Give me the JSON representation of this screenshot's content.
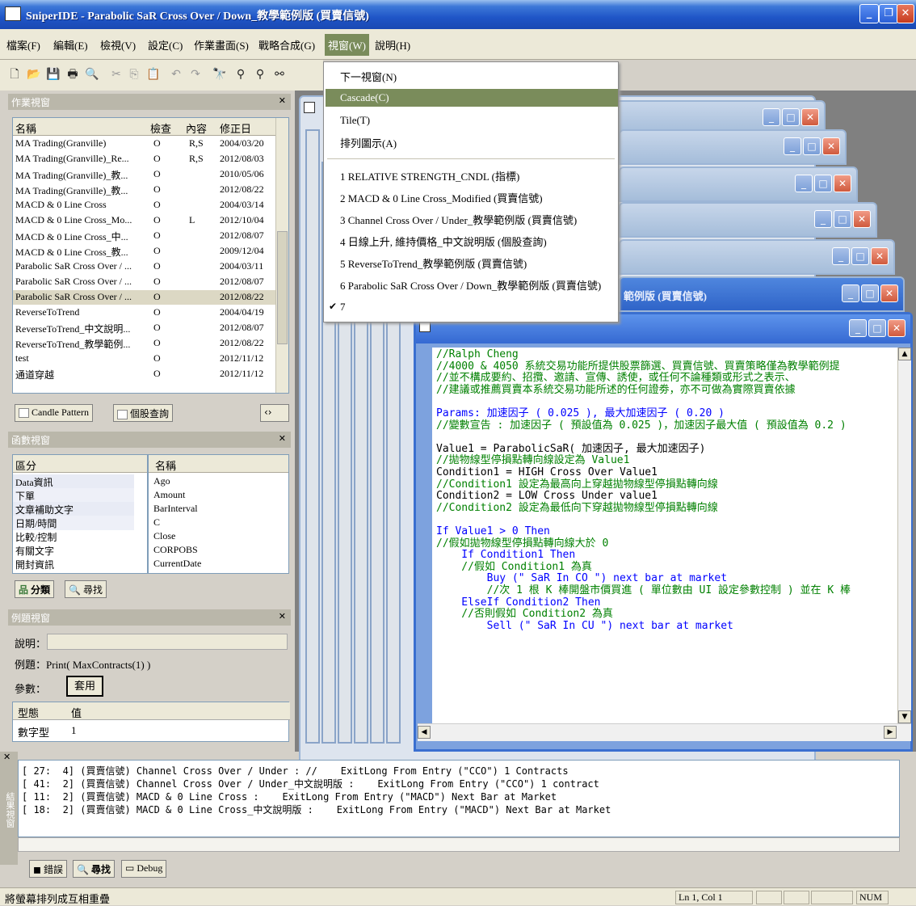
{
  "title": "SniperIDE - Parabolic SaR Cross Over / Down_教學範例版 (買賣信號)",
  "menu": [
    "檔案(F)",
    "編輯(E)",
    "檢視(V)",
    "設定(C)",
    "作業畫面(S)",
    "戰略合成(G)",
    "視窗(W)",
    "說明(H)"
  ],
  "window_menu": {
    "next": "下一視窗(N)",
    "cascade": "Cascade(C)",
    "tile": "Tile(T)",
    "arrange": "排列圖示(A)",
    "windows": [
      "1 RELATIVE STRENGTH_CNDL (指標)",
      "2 MACD & 0 Line Cross_Modified (買賣信號)",
      "3 Channel Cross Over / Under_教學範例版 (買賣信號)",
      "4 日線上升, 維持價格_中文說明版 (個股查詢)",
      "5 ReverseToTrend_教學範例版 (買賣信號)",
      "6 Parabolic SaR Cross Over / Down_教學範例版 (買賣信號)",
      "7"
    ]
  },
  "work_panel": {
    "title": "作業視窗",
    "headers": [
      "名稱",
      "檢查",
      "內容",
      "修正日"
    ],
    "rows": [
      [
        "MA Trading(Granville)",
        "O",
        "R,S",
        "2004/03/20"
      ],
      [
        "MA Trading(Granville)_Re...",
        "O",
        "R,S",
        "2012/08/03"
      ],
      [
        "MA Trading(Granville)_教...",
        "O",
        "",
        "2010/05/06"
      ],
      [
        "MA Trading(Granville)_教...",
        "O",
        "",
        "2012/08/22"
      ],
      [
        "MACD & 0 Line Cross",
        "O",
        "",
        "2004/03/14"
      ],
      [
        "MACD & 0 Line Cross_Mo...",
        "O",
        "L",
        "2012/10/04"
      ],
      [
        "MACD & 0 Line Cross_中...",
        "O",
        "",
        "2012/08/07"
      ],
      [
        "MACD & 0 Line Cross_教...",
        "O",
        "",
        "2009/12/04"
      ],
      [
        "Parabolic SaR Cross Over / ...",
        "O",
        "",
        "2004/03/11"
      ],
      [
        "Parabolic SaR Cross Over / ...",
        "O",
        "",
        "2012/08/07"
      ],
      [
        "Parabolic SaR Cross Over / ...",
        "O",
        "",
        "2012/08/22"
      ],
      [
        "ReverseToTrend",
        "O",
        "",
        "2004/04/19"
      ],
      [
        "ReverseToTrend_中文說明...",
        "O",
        "",
        "2012/08/07"
      ],
      [
        "ReverseToTrend_教學範例...",
        "O",
        "",
        "2012/08/22"
      ],
      [
        "test",
        "O",
        "",
        "2012/11/12"
      ],
      [
        "通道穿越",
        "O",
        "",
        "2012/11/12"
      ]
    ],
    "tabs": [
      "Candle Pattern",
      "個股查詢"
    ]
  },
  "func_panel": {
    "title": "函數視窗",
    "col1": "區分",
    "col2": "名稱",
    "categories": [
      "Data資訊",
      "下單",
      "文章補助文字",
      "日期/時間",
      "比較/控制",
      "有關文字",
      "開封資訊"
    ],
    "names": [
      "Ago",
      "Amount",
      "BarInterval",
      "C",
      "Close",
      "CORPOBS",
      "CurrentDate"
    ],
    "tabs": [
      "分類",
      "尋找"
    ]
  },
  "example_panel": {
    "title": "例題視窗",
    "desc_label": "說明：",
    "example_label": "例題：",
    "example_value": "Print( MaxContracts(1) )",
    "param_label": "參數：",
    "apply_button": "套用",
    "type_header": "型態",
    "value_header": "值",
    "type_row": "數字型",
    "value_row": "1"
  },
  "mdi_tail": "範例版 (買賣信號)",
  "code": [
    {
      "t": "//Ralph Cheng",
      "c": "green"
    },
    {
      "t": "//4000 & 4050 系統交易功能所提供股票篩選、買賣信號、買賣策略僅為教學範例提",
      "c": "green"
    },
    {
      "t": "//並不構成要約、招攬、邀請、宣傳、誘使，或任何不論種類或形式之表示、",
      "c": "green"
    },
    {
      "t": "//建議或推薦買賣本系統交易功能所述的任何證劵，亦不可做為實際買賣依據",
      "c": "green"
    },
    {
      "t": "",
      "c": "blk"
    },
    {
      "t": "Params: 加速因子 ( 0.025 ), 最大加速因子 ( 0.20 )",
      "c": "blue"
    },
    {
      "t": "//變數宣告 : 加速因子 ( 預設值為 0.025 )，加速因子最大值 ( 預設值為 0.2 )",
      "c": "green"
    },
    {
      "t": "",
      "c": "blk"
    },
    {
      "t": "Value1 = ParabolicSaR( 加速因子, 最大加速因子)",
      "c": "blk"
    },
    {
      "t": "//拋物線型停損點轉向線設定為 Value1",
      "c": "green"
    },
    {
      "t": "Condition1 = HIGH Cross Over Value1",
      "c": "blk"
    },
    {
      "t": "//Condition1 設定為最高向上穿越拋物線型停損點轉向線",
      "c": "green"
    },
    {
      "t": "Condition2 = LOW Cross Under value1",
      "c": "blk"
    },
    {
      "t": "//Condition2 設定為最低向下穿越拋物線型停損點轉向線",
      "c": "green"
    },
    {
      "t": "",
      "c": "blk"
    },
    {
      "t": "If Value1 > 0 Then",
      "c": "blue"
    },
    {
      "t": "//假如拋物線型停損點轉向線大於 0",
      "c": "green"
    },
    {
      "t": "    If Condition1 Then",
      "c": "blue"
    },
    {
      "t": "    //假如 Condition1 為真",
      "c": "green"
    },
    {
      "t": "        Buy (\" SaR In CO \") next bar at market",
      "c": "blue"
    },
    {
      "t": "        //次 1 根 K 棒開盤市價買進 ( 單位數由 UI 設定參數控制 ) 並在 K 棒",
      "c": "green"
    },
    {
      "t": "    ElseIf Condition2 Then",
      "c": "blue"
    },
    {
      "t": "    //否則假如 Condition2 為真",
      "c": "green"
    },
    {
      "t": "        Sell (\" SaR In CU \") next bar at market",
      "c": "blue"
    }
  ],
  "output": [
    "[ 27:  4] (買賣信號) Channel Cross Over / Under : //    ExitLong From Entry (\"CCO\") 1 Contracts",
    "[ 41:  2] (買賣信號) Channel Cross Over / Under_中文說明版 :    ExitLong From Entry (\"CCO\") 1 contract",
    "[ 11:  2] (買賣信號) MACD & 0 Line Cross :    ExitLong From Entry (\"MACD\") Next Bar at Market",
    "[ 18:  2] (買賣信號) MACD & 0 Line Cross_中文說明版 :    ExitLong From Entry (\"MACD\") Next Bar at Market"
  ],
  "output_side_label": "結果視窗",
  "output_tabs": [
    "錯誤",
    "尋找",
    "Debug"
  ],
  "status": {
    "message": "將螢幕排列成互相重疊",
    "pos": "Ln 1, Col 1",
    "num": "NUM"
  }
}
